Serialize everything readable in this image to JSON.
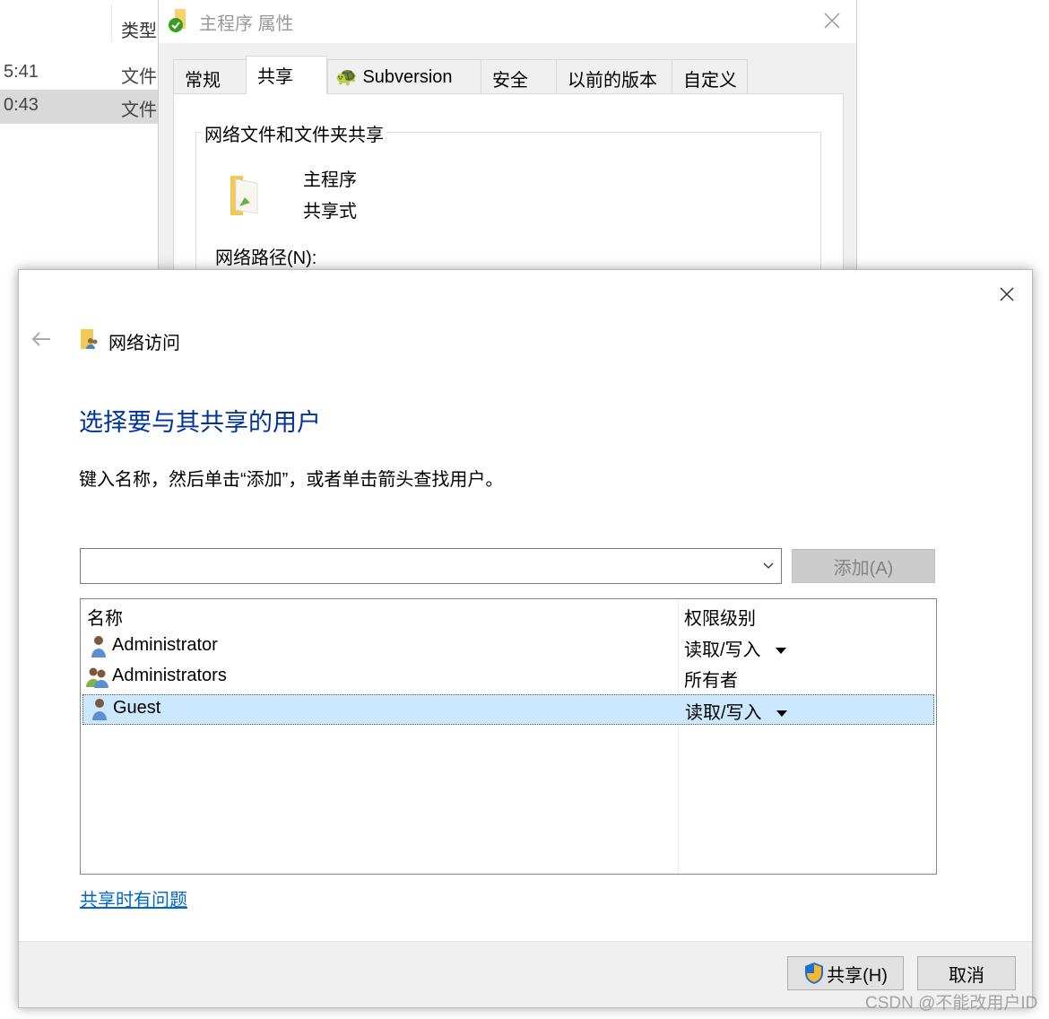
{
  "explorer": {
    "column_type": "类型",
    "rows": [
      {
        "time": "5:41",
        "type": "文件"
      },
      {
        "time": "0:43",
        "type": "文件",
        "selected": true
      }
    ]
  },
  "properties": {
    "title": "主程序 属性",
    "tabs": [
      "常规",
      "共享",
      "Subversion",
      "安全",
      "以前的版本",
      "自定义"
    ],
    "active_tab": "共享",
    "group_label": "网络文件和文件夹共享",
    "folder_name": "主程序",
    "share_state": "共享式",
    "network_path_label": "网络路径(N):"
  },
  "dialog": {
    "breadcrumb": "网络访问",
    "heading": "选择要与其共享的用户",
    "instruction": "键入名称，然后单击“添加”，或者单击箭头查找用户。",
    "combo_value": "",
    "add_button": "添加(A)",
    "columns": {
      "name": "名称",
      "permission": "权限级别"
    },
    "users": [
      {
        "name": "Administrator",
        "permission": "读取/写入",
        "icon": "user-icon",
        "dropdown": true
      },
      {
        "name": "Administrators",
        "permission": "所有者",
        "icon": "group-icon",
        "dropdown": false
      },
      {
        "name": "Guest",
        "permission": "读取/写入",
        "icon": "user-icon",
        "dropdown": true,
        "selected": true
      }
    ],
    "help_link": "共享时有问题",
    "share_button": "共享(H)",
    "cancel_button": "取消",
    "heading_color": "#003399",
    "link_color": "#0066cc"
  },
  "watermark": "CSDN @不能改用户ID"
}
